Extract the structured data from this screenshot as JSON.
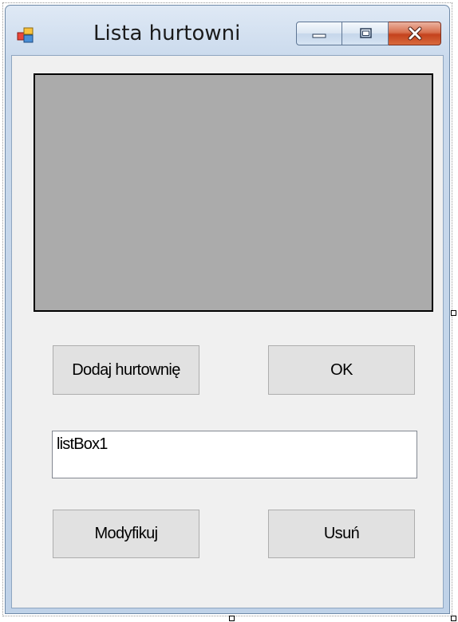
{
  "window": {
    "title": "Lista hurtowni",
    "controls": {
      "minimize_icon": "minimize-icon",
      "maximize_icon": "maximize-icon",
      "close_icon": "close-icon"
    },
    "app_icon": "form-icon"
  },
  "form": {
    "panel": {
      "color": "#ababab"
    },
    "buttons": {
      "add_label": "Dodaj hurtownię",
      "ok_label": "OK",
      "modify_label": "Modyfikuj",
      "delete_label": "Usuń"
    },
    "listbox": {
      "name": "listBox1"
    }
  },
  "colors": {
    "client_bg": "#f0f0f0",
    "button_bg": "#e1e1e1",
    "close_button": "#c4421d"
  }
}
